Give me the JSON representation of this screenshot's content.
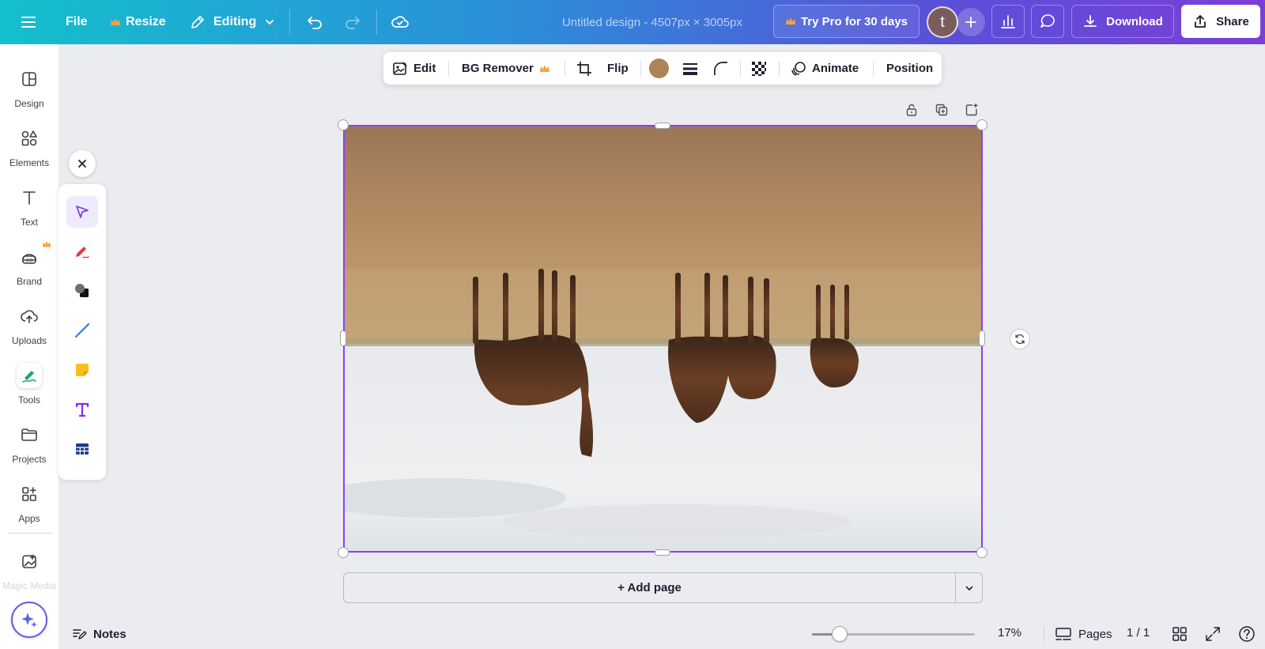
{
  "header": {
    "menu_icon": "hamburger-icon",
    "file_label": "File",
    "resize_label": "Resize",
    "editing_label": "Editing",
    "title": "Untitled design - 4507px × 3005px",
    "try_pro_label": "Try Pro for 30 days",
    "avatar_letter": "t",
    "download_label": "Download",
    "share_label": "Share",
    "crown_color": "#f6a43a"
  },
  "rail": {
    "items": [
      {
        "label": "Design",
        "icon": "design-icon"
      },
      {
        "label": "Elements",
        "icon": "elements-icon"
      },
      {
        "label": "Text",
        "icon": "text-icon"
      },
      {
        "label": "Brand",
        "icon": "brand-icon"
      },
      {
        "label": "Uploads",
        "icon": "uploads-icon"
      },
      {
        "label": "Tools",
        "icon": "tools-icon"
      },
      {
        "label": "Projects",
        "icon": "projects-icon"
      },
      {
        "label": "Apps",
        "icon": "apps-icon"
      },
      {
        "label": "Magic Media",
        "icon": "magic-media-icon"
      }
    ]
  },
  "tools_panel": {
    "tools": [
      "select-icon",
      "pen-icon",
      "shapes-icon",
      "line-icon",
      "sticky-note-icon",
      "text-tool-icon",
      "table-icon"
    ]
  },
  "floating_toolbar": {
    "edit_label": "Edit",
    "bg_remover_label": "BG Remover",
    "flip_label": "Flip",
    "swatch_color": "#ad8458",
    "animate_label": "Animate",
    "position_label": "Position"
  },
  "canvas": {
    "add_page_label": "+ Add page",
    "accent_color": "#8b3dff"
  },
  "bottom_bar": {
    "notes_label": "Notes",
    "zoom_label": "17%",
    "zoom_value": 0.17,
    "pages_label": "Pages",
    "page_count": "1 / 1"
  }
}
